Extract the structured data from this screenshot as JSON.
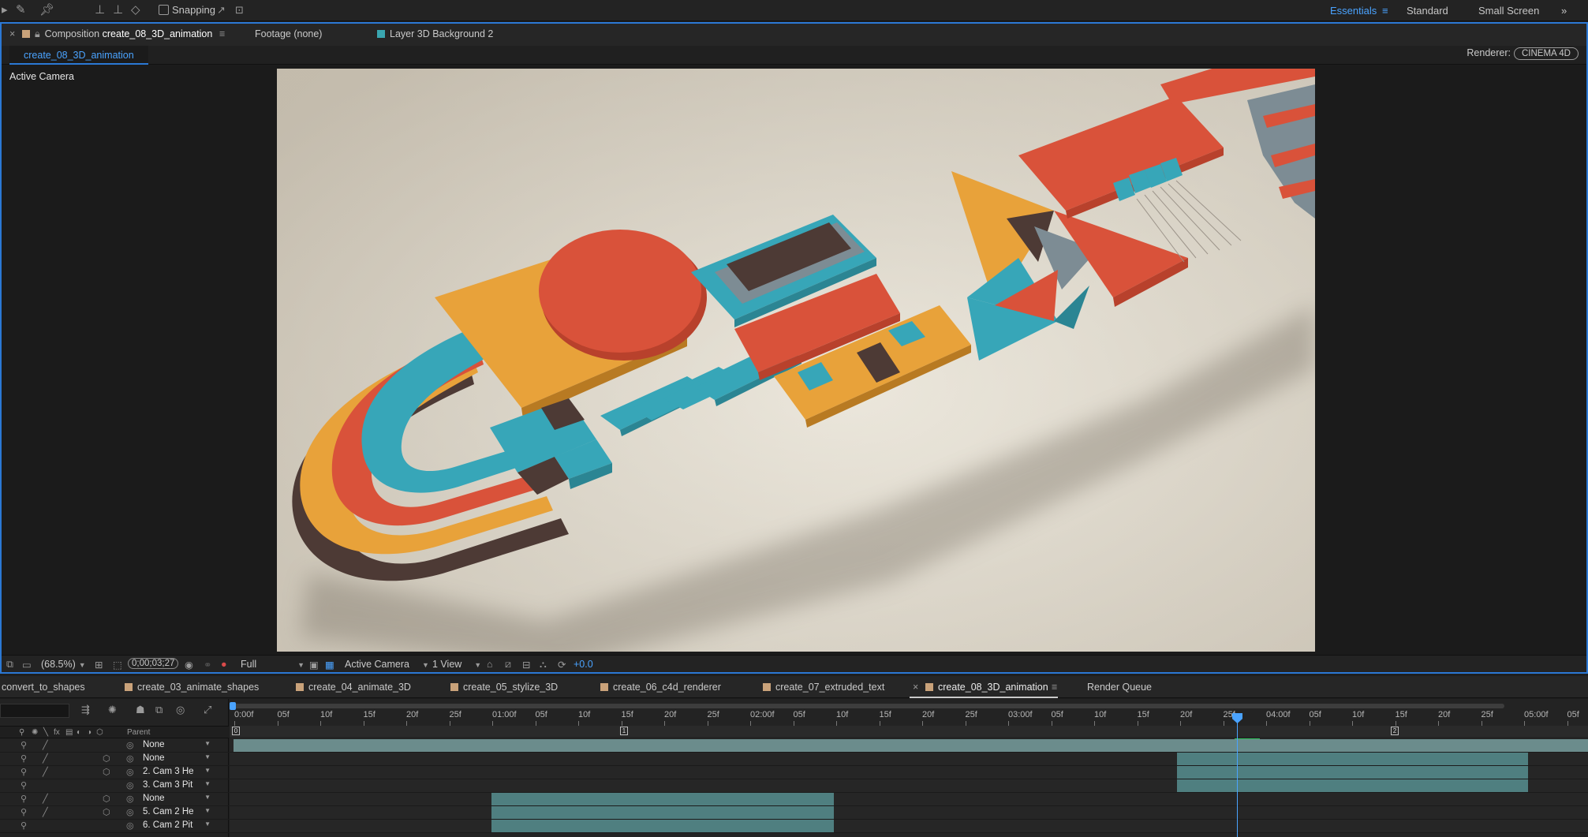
{
  "toolbar": {
    "snapping_label": "Snapping",
    "workspaces": [
      "Essentials",
      "Standard",
      "Small Screen"
    ],
    "overflow": "»"
  },
  "comp_panel": {
    "close": "×",
    "menu": "≡",
    "composition_prefix": "Composition",
    "composition_name": "create_08_3D_animation",
    "footage_tab": "Footage (none)",
    "layer_tab": "Layer 3D Background 2",
    "sub_tab": "create_08_3D_animation",
    "renderer_label": "Renderer:",
    "renderer_value": "CINEMA 4D",
    "view_label": "Active Camera"
  },
  "viewer_bar": {
    "zoom": "(68.5%)",
    "timecode": "0;00;03;27",
    "resolution": "Full",
    "camera": "Active Camera",
    "views": "1 View",
    "exposure": "+0.0"
  },
  "timeline_tabs": [
    "convert_to_shapes",
    "create_03_animate_shapes",
    "create_04_animate_3D",
    "create_05_stylize_3D",
    "create_06_c4d_renderer",
    "create_07_extruded_text",
    "create_08_3D_animation",
    "Render Queue"
  ],
  "timeline_close": "×",
  "timeline_menu": "≡",
  "colors": {
    "accent": "#2b78d4",
    "link_blue": "#4aa3ff",
    "track": "#4f7f80",
    "swatch_tan": "#c9a27a",
    "swatch_teal": "#3aa6b0",
    "scene_orange": "#e8a23a",
    "scene_red": "#d9523a",
    "scene_teal": "#37a6b8",
    "scene_brown": "#4d3a35",
    "scene_gray": "#7d8c94"
  },
  "columns": {
    "parent": "Parent"
  },
  "layers": [
    {
      "parent": "None"
    },
    {
      "parent": "None"
    },
    {
      "parent": "2. Cam 3 He"
    },
    {
      "parent": "3. Cam 3 Pit"
    },
    {
      "parent": "None"
    },
    {
      "parent": "5. Cam 2 He"
    },
    {
      "parent": "6. Cam 2 Pit"
    }
  ],
  "ruler_ticks": [
    "0:00f",
    "05f",
    "10f",
    "15f",
    "20f",
    "25f",
    "01:00f",
    "05f",
    "10f",
    "15f",
    "20f",
    "25f",
    "02:00f",
    "05f",
    "10f",
    "15f",
    "20f",
    "25f",
    "03:00f",
    "05f",
    "10f",
    "15f",
    "20f",
    "25f",
    "04:00f",
    "05f",
    "10f",
    "15f",
    "20f",
    "25f",
    "05:00f",
    "05f"
  ],
  "markers": [
    "0",
    "1",
    "2"
  ],
  "icons": {
    "comp_icon": "composition-icon",
    "lock": "lock-icon",
    "camera": "camera-icon",
    "snapshot": "snapshot-icon",
    "color": "color-channels-icon"
  }
}
